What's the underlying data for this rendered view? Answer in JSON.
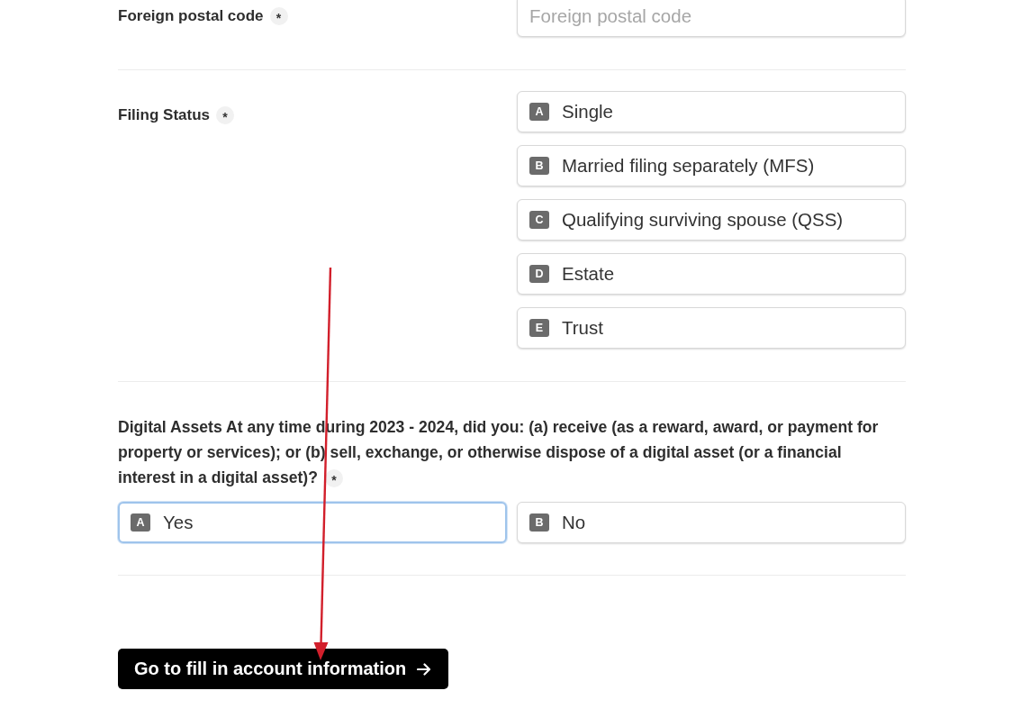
{
  "questions": [
    {
      "kind": "text",
      "label": "Foreign postal code",
      "required_mark": "*",
      "placeholder": "Foreign postal code"
    },
    {
      "kind": "choice_list",
      "label": "Filing Status",
      "required_mark": "*",
      "options": [
        {
          "key": "A",
          "label": "Single",
          "selected": false
        },
        {
          "key": "B",
          "label": "Married filing separately (MFS)",
          "selected": false
        },
        {
          "key": "C",
          "label": "Qualifying surviving spouse (QSS)",
          "selected": false
        },
        {
          "key": "D",
          "label": "Estate",
          "selected": false
        },
        {
          "key": "E",
          "label": "Trust",
          "selected": false
        }
      ]
    },
    {
      "kind": "choice_grid",
      "label": "Digital Assets At any time during 2023 - 2024, did you: (a) receive (as a reward, award, or payment for property or services); or (b) sell, exchange, or otherwise dispose of a digital asset (or a financial interest in a digital asset)?",
      "required_mark": "*",
      "options": [
        {
          "key": "A",
          "label": "Yes",
          "selected": true
        },
        {
          "key": "B",
          "label": "No",
          "selected": false
        }
      ]
    }
  ],
  "submit_button": {
    "label": "Go to fill in account information"
  },
  "annotations": [
    {
      "kind": "arrow"
    }
  ]
}
